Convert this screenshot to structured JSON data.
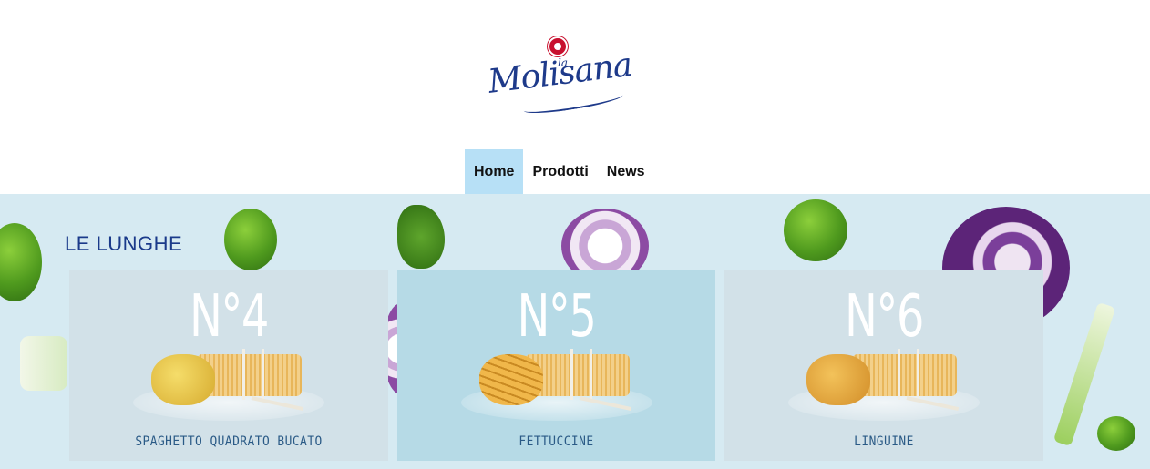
{
  "brand": {
    "logo_small": "la",
    "logo_main": "Molisana"
  },
  "nav": {
    "items": [
      {
        "label": "Home",
        "active": true
      },
      {
        "label": "Prodotti",
        "active": false
      },
      {
        "label": "News",
        "active": false
      }
    ]
  },
  "section": {
    "title": "LE LUNGHE"
  },
  "products": [
    {
      "number": "N°4",
      "name": "SPAGHETTO QUADRATO BUCATO"
    },
    {
      "number": "N°5",
      "name": "FETTUCCINE"
    },
    {
      "number": "N°6",
      "name": "LINGUINE"
    }
  ],
  "colors": {
    "brand_blue": "#1a3a8a",
    "nav_active_bg": "#b7e0f6",
    "hero_bg": "#d6eaf2",
    "card_bg": "#d2e1e8",
    "card_bg_highlight": "#b6dae6",
    "label_color": "#2a5a86"
  }
}
